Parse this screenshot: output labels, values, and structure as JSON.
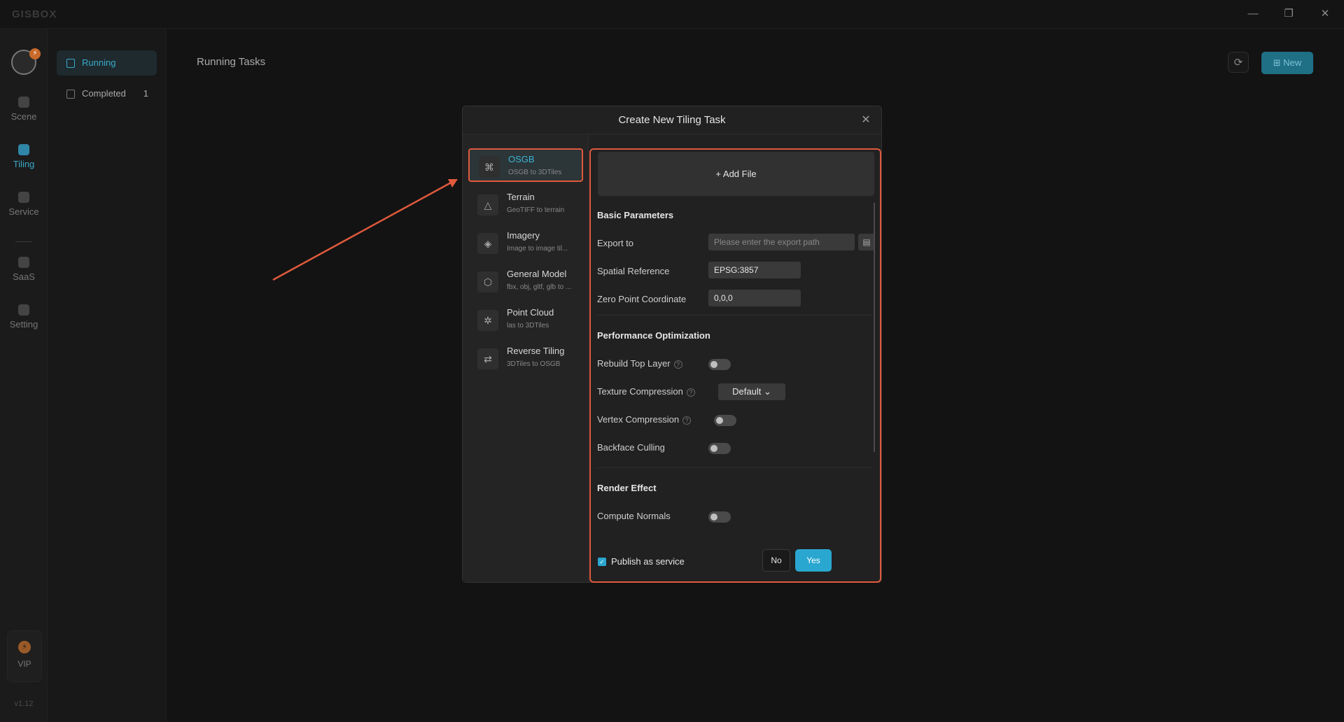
{
  "app": {
    "logo": "GISBOX",
    "version": "v1.12"
  },
  "window_controls": {
    "minimize": "—",
    "restore": "❐",
    "close": "✕"
  },
  "rail": {
    "avatar_badge": "⚡",
    "items": [
      {
        "label": "Scene",
        "active": false
      },
      {
        "label": "Tiling",
        "active": true
      },
      {
        "label": "Service",
        "active": false
      },
      {
        "label": "SaaS",
        "active": false
      },
      {
        "label": "Setting",
        "active": false
      }
    ],
    "vip_label": "VIP",
    "vip_icon": "⚡"
  },
  "subnav": {
    "items": [
      {
        "label": "Running",
        "active": true,
        "count": ""
      },
      {
        "label": "Completed",
        "active": false,
        "count": "1"
      }
    ]
  },
  "main": {
    "title": "Running Tasks",
    "refresh_icon": "⟳",
    "new_label": "New",
    "new_icon": "⊞"
  },
  "dialog": {
    "title": "Create New Tiling Task",
    "close_icon": "✕",
    "types": [
      {
        "name": "OSGB",
        "desc": "OSGB to 3DTiles",
        "icon": "⌘",
        "active": true
      },
      {
        "name": "Terrain",
        "desc": "GeoTIFF to terrain",
        "icon": "△",
        "active": false
      },
      {
        "name": "Imagery",
        "desc": "Image to image til...",
        "icon": "◈",
        "active": false
      },
      {
        "name": "General Model",
        "desc": "fbx, obj, gltf, glb to ...",
        "icon": "⬡",
        "active": false
      },
      {
        "name": "Point Cloud",
        "desc": "las to 3DTiles",
        "icon": "✲",
        "active": false
      },
      {
        "name": "Reverse Tiling",
        "desc": "3DTiles to OSGB",
        "icon": "⇄",
        "active": false
      }
    ],
    "add_file_label": "+ Add File",
    "basic": {
      "title": "Basic Parameters",
      "export_label": "Export to",
      "export_placeholder": "Please enter the export path",
      "export_value": "",
      "browse_icon": "▤",
      "spatial_label": "Spatial Reference",
      "spatial_value": "EPSG:3857",
      "zero_label": "Zero Point Coordinate",
      "zero_value": "0,0,0"
    },
    "performance": {
      "title": "Performance Optimization",
      "rebuild_label": "Rebuild Top Layer",
      "rebuild_on": false,
      "texture_label": "Texture Compression",
      "texture_value": "Default",
      "texture_chevron": "⌄",
      "vertex_label": "Vertex Compression",
      "vertex_on": false,
      "backface_label": "Backface Culling",
      "backface_on": false,
      "help_icon": "?"
    },
    "render": {
      "title": "Render Effect",
      "normals_label": "Compute Normals",
      "normals_on": false
    },
    "publish_label": "Publish as service",
    "publish_checked": true,
    "check_icon": "✓",
    "no_label": "No",
    "yes_label": "Yes"
  },
  "colors": {
    "accent": "#2aa7d0",
    "annotation": "#e05a3c"
  }
}
